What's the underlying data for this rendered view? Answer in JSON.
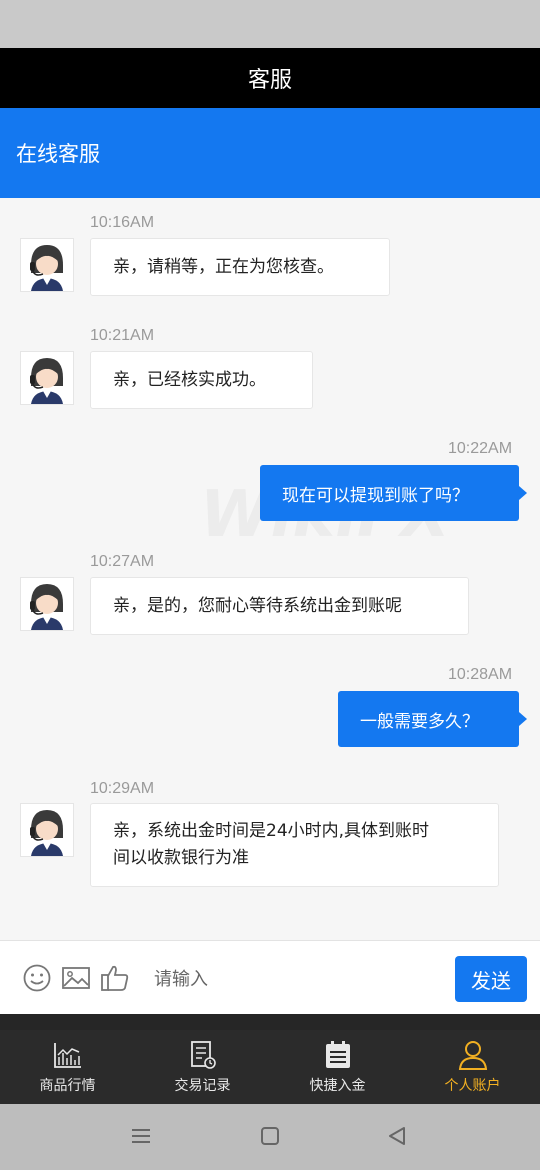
{
  "header": {
    "title": "客服"
  },
  "service_bar": {
    "label": "在线客服"
  },
  "watermark": "WikiFX",
  "messages": [
    {
      "from": "agent",
      "time": "10:16AM",
      "text": "亲，请稍等，正在为您核查。"
    },
    {
      "from": "agent",
      "time": "10:21AM",
      "text": "亲，已经核实成功。"
    },
    {
      "from": "user",
      "time": "10:22AM",
      "text": "现在可以提现到账了吗？"
    },
    {
      "from": "agent",
      "time": "10:27AM",
      "text": "亲，是的，您耐心等待系统出金到账呢"
    },
    {
      "from": "user",
      "time": "10:28AM",
      "text": "一般需要多久？"
    },
    {
      "from": "agent",
      "time": "10:29AM",
      "text_line1": "亲，系统出金时间是24小时内,具体到账时",
      "text_line2": "间以收款银行为准"
    }
  ],
  "input": {
    "placeholder": "请输入",
    "send_label": "发送",
    "icons": [
      "emoji-icon",
      "image-icon",
      "thumbs-up-icon"
    ]
  },
  "tabs": [
    {
      "label": "商品行情",
      "icon": "chart-icon",
      "active": false
    },
    {
      "label": "交易记录",
      "icon": "record-icon",
      "active": false
    },
    {
      "label": "快捷入金",
      "icon": "calendar-icon",
      "active": false
    },
    {
      "label": "个人账户",
      "icon": "user-icon",
      "active": true
    }
  ],
  "colors": {
    "primary": "#1478f0",
    "active_tab": "#f2b022",
    "header_bg": "#000000"
  }
}
